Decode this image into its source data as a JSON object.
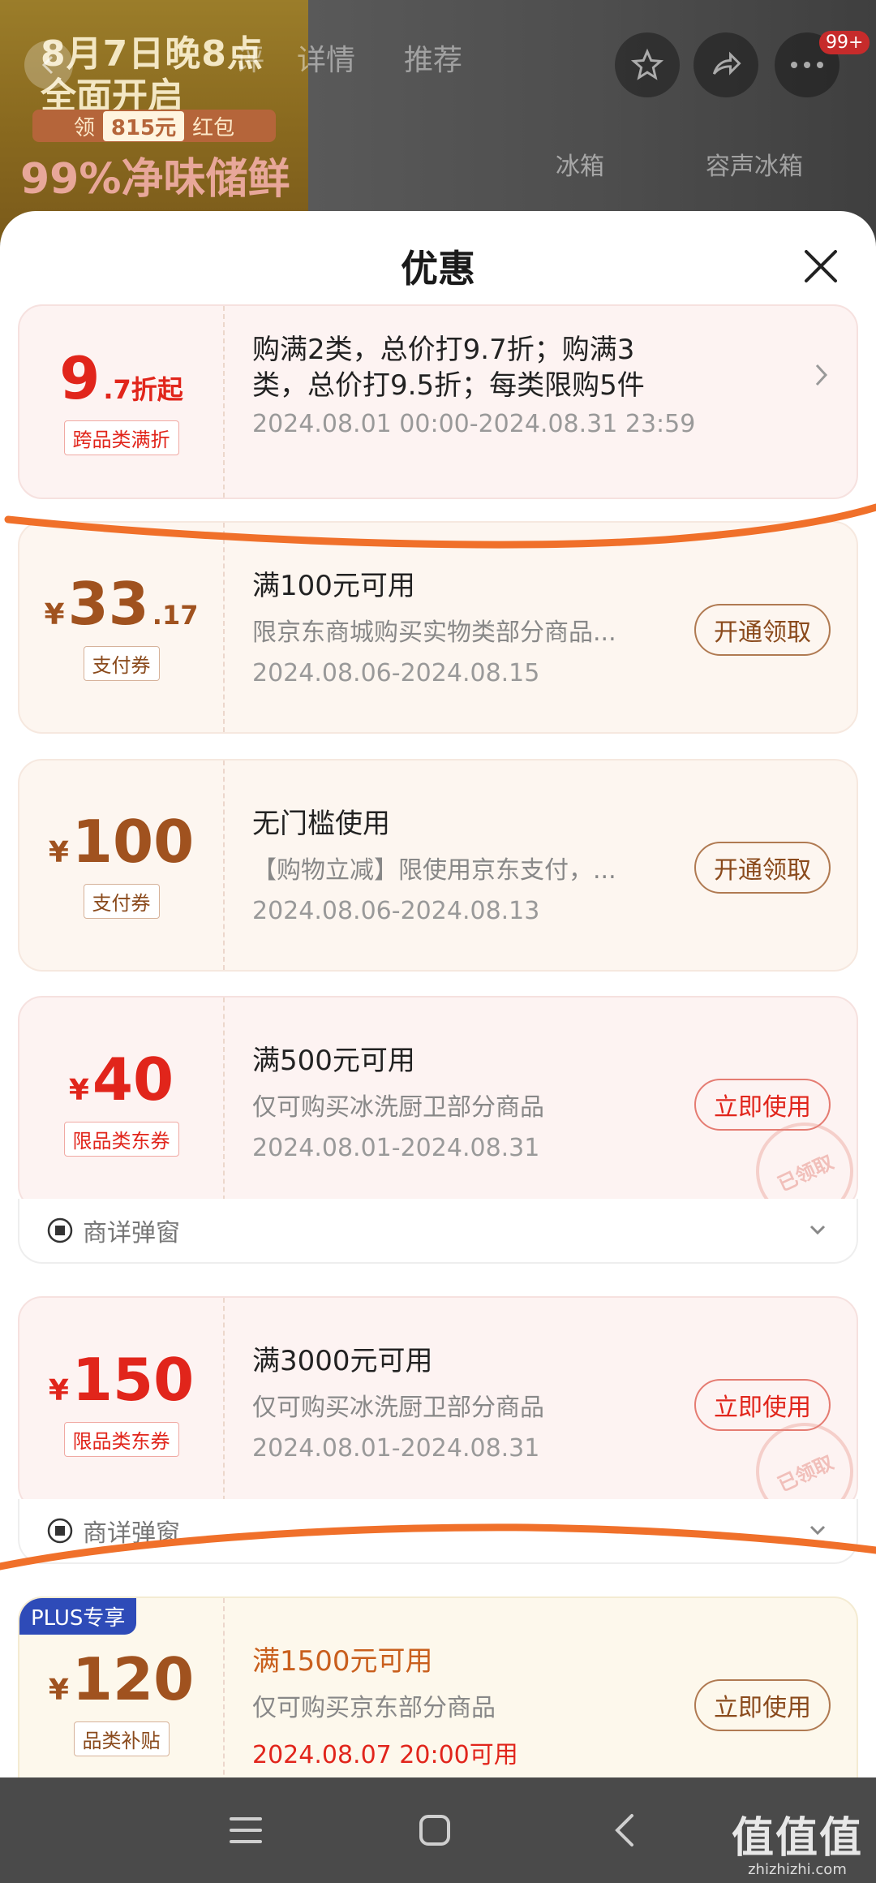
{
  "background": {
    "promo_line1": "8月7日晚8点",
    "promo_line2": "全面开启",
    "promo_redpack_prefix": "领",
    "promo_redpack_amount": "815元",
    "promo_redpack_suffix": "红包",
    "promo_line3": "99%净味储鲜",
    "tabs": [
      "详情",
      "推荐"
    ],
    "tab_partial": "评",
    "cart_badge": "99+",
    "subtabs": [
      "冰箱",
      "容声冰箱"
    ]
  },
  "sheet": {
    "title": "优惠"
  },
  "offers": [
    {
      "style": "pink",
      "amount_big": "9",
      "amount_small": ".7折起",
      "tag": "跨品类满折",
      "title_line1": "购满2类，总价打9.7折；购满3",
      "title_line2": "类，总价打9.5折；每类限购5件",
      "date": "2024.08.01 00:00-2024.08.31 23:59"
    },
    {
      "style": "beige",
      "currency": "¥",
      "amount_big": "33",
      "amount_small": ".17",
      "tag": "支付券",
      "title": "满100元可用",
      "desc": "限京东商城购买实物类部分商品...",
      "date": "2024.08.06-2024.08.15",
      "button": "开通领取"
    },
    {
      "style": "beige",
      "currency": "¥",
      "amount_big": "100",
      "tag": "支付券",
      "title": "无门槛使用",
      "desc": "【购物立减】限使用京东支付，...",
      "date": "2024.08.06-2024.08.13",
      "button": "开通领取"
    },
    {
      "style": "pink",
      "currency": "¥",
      "amount_big": "40",
      "tag": "限品类东券",
      "title": "满500元可用",
      "desc": "仅可购买冰洗厨卫部分商品",
      "date": "2024.08.01-2024.08.31",
      "button": "立即使用",
      "stamp": "已领取",
      "footer": "商详弹窗"
    },
    {
      "style": "pink",
      "currency": "¥",
      "amount_big": "150",
      "tag": "限品类东券",
      "title": "满3000元可用",
      "desc": "仅可购买冰洗厨卫部分商品",
      "date": "2024.08.01-2024.08.31",
      "button": "立即使用",
      "stamp": "已领取",
      "footer": "商详弹窗"
    },
    {
      "style": "plus",
      "badge": "PLUS专享",
      "currency": "¥",
      "amount_big": "120",
      "tag": "品类补贴",
      "title": "满1500元可用",
      "desc": "仅可购买京东部分商品",
      "date": "2024.08.07 20:00可用",
      "button": "立即使用"
    }
  ],
  "watermark": {
    "logo": "值值值",
    "site": "zhizhizhi.com"
  },
  "colors": {
    "accent_red": "#e1251b",
    "brown": "#a0521f",
    "scribble_orange": "#f0702a",
    "plus_blue": "#2e4bb8"
  }
}
